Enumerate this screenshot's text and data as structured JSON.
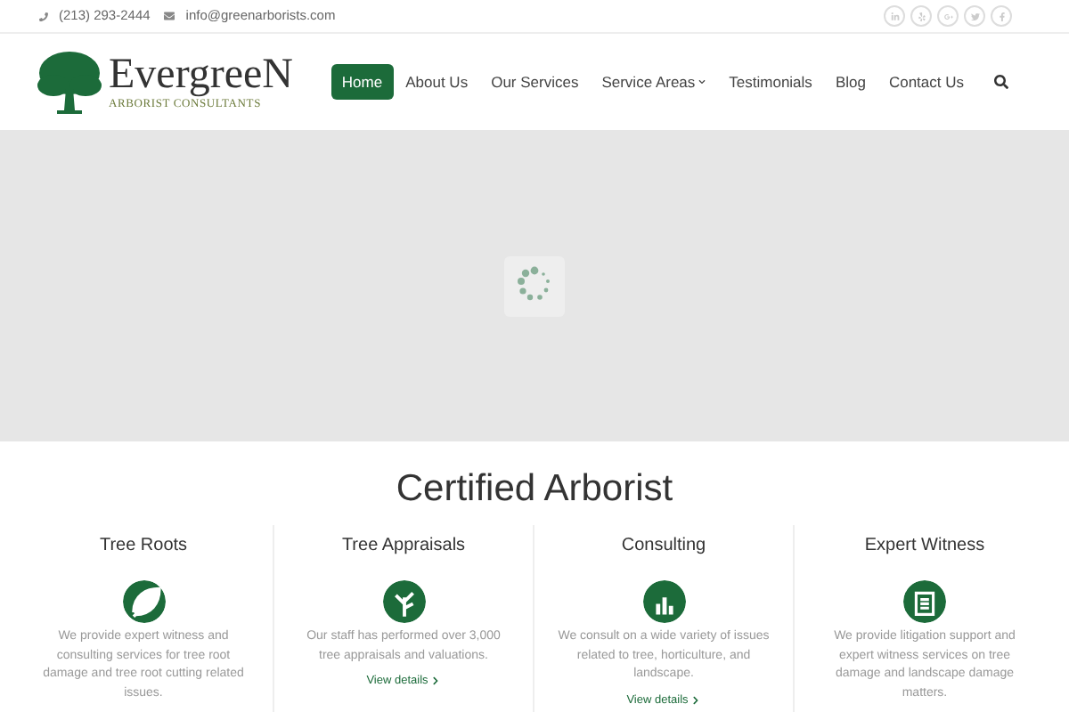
{
  "topbar": {
    "phone": "(213) 293-2444",
    "email": "info@greenarborists.com"
  },
  "logo": {
    "name": "EvergreeN",
    "tagline": "ARBORIST CONSULTANTS"
  },
  "nav": [
    {
      "label": "Home",
      "selected": true,
      "has_dropdown": false
    },
    {
      "label": "About Us",
      "selected": false,
      "has_dropdown": false
    },
    {
      "label": "Our Services",
      "selected": false,
      "has_dropdown": false
    },
    {
      "label": "Service Areas",
      "selected": false,
      "has_dropdown": true
    },
    {
      "label": "Testimonials",
      "selected": false,
      "has_dropdown": false
    },
    {
      "label": "Blog",
      "selected": false,
      "has_dropdown": false
    },
    {
      "label": "Contact Us",
      "selected": false,
      "has_dropdown": false
    }
  ],
  "section": {
    "title": "Certified Arborist"
  },
  "services": [
    {
      "title": "Tree Roots",
      "kind": "leaf",
      "text": "We provide expert witness and consulting services for tree root damage and tree root cutting related issues."
    },
    {
      "title": "Tree Appraisals",
      "kind": "tree",
      "text": "Our staff has performed over 3,000 tree appraisals and valuations.",
      "link": "View details"
    },
    {
      "title": "Consulting",
      "kind": "chart",
      "text": "We consult on a wide variety of issues related to tree, horticulture, and landscape.",
      "link": "View details"
    },
    {
      "title": "Expert Witness",
      "kind": "clipboard",
      "text": "We provide litigation support and expert witness services on tree damage and landscape damage matters."
    }
  ]
}
